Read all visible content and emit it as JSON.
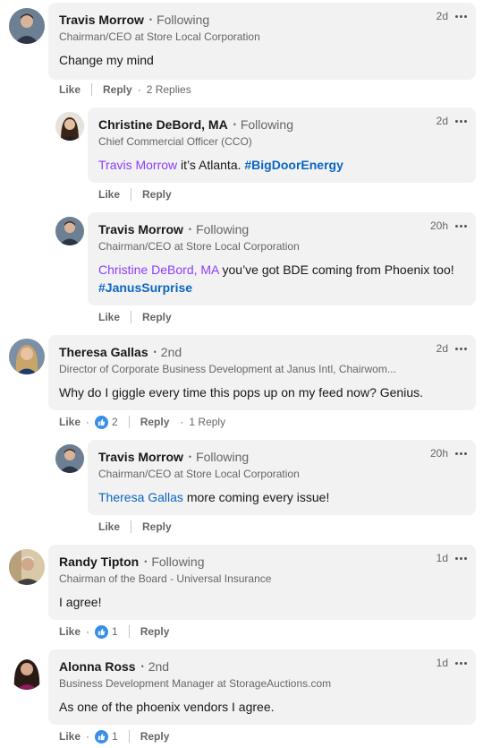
{
  "colors": {
    "bubble": "#f2f2f2",
    "mention_purple": "#8a3ffc",
    "link_blue": "#0a66c2",
    "like_blue": "#378fe9",
    "muted": "#666666"
  },
  "comments": [
    {
      "name": "Travis Morrow",
      "degree": "Following",
      "headline": "Chairman/CEO at Store Local Corporation",
      "time": "2d",
      "text": "Change my mind",
      "like_label": "Like",
      "reply_label": "Reply",
      "replies_label": "2 Replies"
    },
    {
      "name": "Christine DeBord, MA",
      "degree": "Following",
      "headline": "Chief Commercial Officer (CCO)",
      "time": "2d",
      "mention": "Travis Morrow",
      "text": " it’s Atlanta. ",
      "hashtag": "#BigDoorEnergy",
      "like_label": "Like",
      "reply_label": "Reply"
    },
    {
      "name": "Travis Morrow",
      "degree": "Following",
      "headline": "Chairman/CEO at Store Local Corporation",
      "time": "20h",
      "mention": "Christine DeBord, MA",
      "text": " you’ve got BDE coming from Phoenix too! ",
      "hashtag": "#JanusSurprise",
      "like_label": "Like",
      "reply_label": "Reply"
    },
    {
      "name": "Theresa Gallas",
      "degree": "2nd",
      "headline": "Director of Corporate Business Development at Janus Intl, Chairwom...",
      "time": "2d",
      "text": "Why do I giggle every time this pops up on my feed now? Genius.",
      "like_label": "Like",
      "like_count": "2",
      "reply_label": "Reply",
      "replies_label": "1 Reply"
    },
    {
      "name": "Travis Morrow",
      "degree": "Following",
      "headline": "Chairman/CEO at Store Local Corporation",
      "time": "20h",
      "mention": "Theresa Gallas",
      "text": " more coming every issue!",
      "like_label": "Like",
      "reply_label": "Reply"
    },
    {
      "name": "Randy Tipton",
      "degree": "Following",
      "headline": "Chairman of the Board - Universal Insurance",
      "time": "1d",
      "text": "I agree!",
      "like_label": "Like",
      "like_count": "1",
      "reply_label": "Reply"
    },
    {
      "name": "Alonna Ross",
      "degree": "2nd",
      "headline": "Business Development Manager at StorageAuctions.com",
      "time": "1d",
      "text": "As one of the phoenix vendors I agree.",
      "like_label": "Like",
      "like_count": "1",
      "reply_label": "Reply"
    }
  ]
}
